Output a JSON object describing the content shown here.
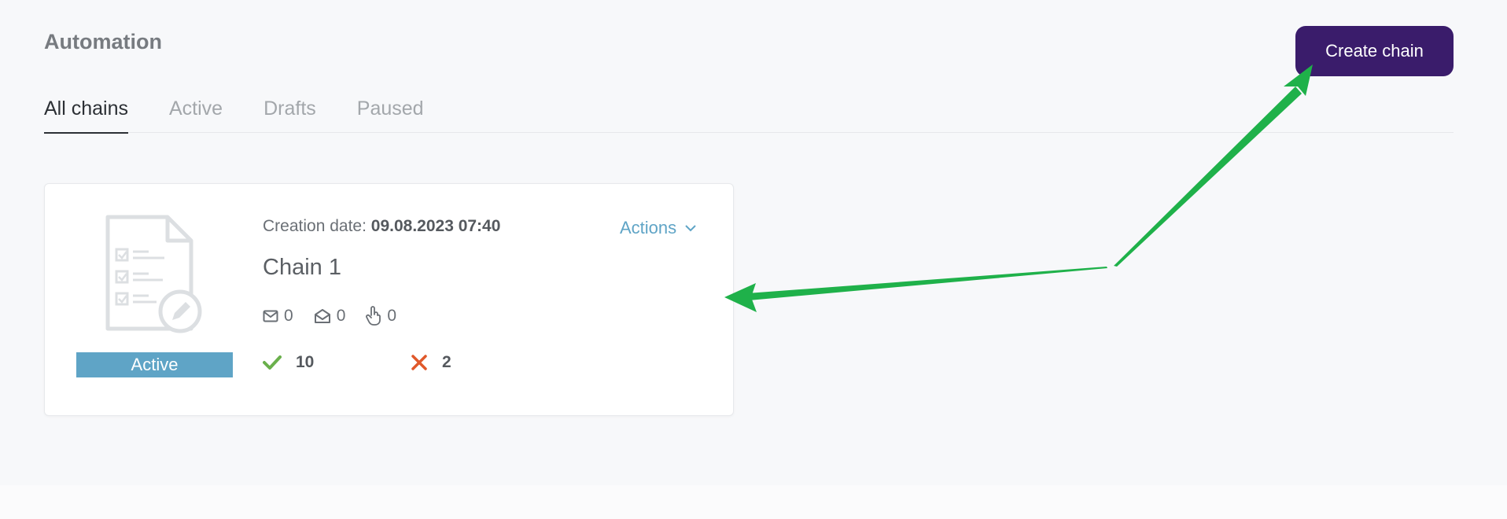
{
  "header": {
    "title": "Automation",
    "create_button": "Create chain"
  },
  "tabs": [
    {
      "label": "All chains",
      "selected": true
    },
    {
      "label": "Active",
      "selected": false
    },
    {
      "label": "Drafts",
      "selected": false
    },
    {
      "label": "Paused",
      "selected": false
    }
  ],
  "chain_card": {
    "status": "Active",
    "creation_label": "Creation date:",
    "creation_value": "09.08.2023 07:40",
    "actions_label": "Actions",
    "name": "Chain 1",
    "stats": {
      "sent": "0",
      "opened": "0",
      "clicked": "0"
    },
    "results": {
      "success": "10",
      "failed": "2"
    }
  },
  "colors": {
    "accent_button": "#3a1c6b",
    "status_badge": "#5fa4c6",
    "success": "#6ab04c",
    "error": "#e0582a",
    "annotation_arrow": "#1fb14a"
  }
}
